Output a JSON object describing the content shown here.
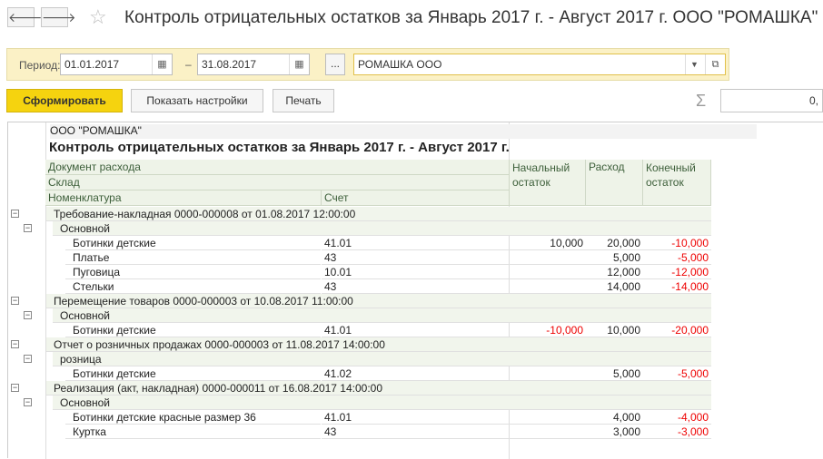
{
  "window": {
    "title": "Контроль отрицательных остатков за Январь 2017 г. - Август 2017 г. ООО \"РОМАШКА\""
  },
  "nav": {
    "back": "🡐",
    "forward": "🡒",
    "star": "☆"
  },
  "params": {
    "period_label": "Период:",
    "date_from": "01.01.2017",
    "date_to": "31.08.2017",
    "dash": "–",
    "dots": "...",
    "org": "РОМАШКА ООО"
  },
  "toolbar": {
    "generate": "Сформировать",
    "settings": "Показать настройки",
    "print": "Печать",
    "sigma": "Σ",
    "sum_value": "0,"
  },
  "report": {
    "org": "ООО \"РОМАШКА\"",
    "title": "Контроль отрицательных остатков за Январь 2017 г. - Август 2017 г.",
    "headers": {
      "doc": "Документ расхода",
      "warehouse": "Склад",
      "item": "Номенклатура",
      "account": "Счет",
      "start": "Начальный остаток",
      "expense": "Расход",
      "end": "Конечный остаток"
    },
    "rows": [
      {
        "level": 1,
        "name": "Требование-накладная 0000-000008 от 01.08.2017 12:00:00",
        "acc": "",
        "start": "",
        "exp": "",
        "end": ""
      },
      {
        "level": 2,
        "name": "Основной",
        "acc": "",
        "start": "",
        "exp": "",
        "end": ""
      },
      {
        "level": 3,
        "name": "Ботинки детские",
        "acc": "41.01",
        "start": "10,000",
        "exp": "20,000",
        "end": "-10,000"
      },
      {
        "level": 3,
        "name": "Платье",
        "acc": "43",
        "start": "",
        "exp": "5,000",
        "end": "-5,000"
      },
      {
        "level": 3,
        "name": "Пуговица",
        "acc": "10.01",
        "start": "",
        "exp": "12,000",
        "end": "-12,000"
      },
      {
        "level": 3,
        "name": "Стельки",
        "acc": "43",
        "start": "",
        "exp": "14,000",
        "end": "-14,000"
      },
      {
        "level": 1,
        "name": "Перемещение товаров 0000-000003 от 10.08.2017 11:00:00",
        "acc": "",
        "start": "",
        "exp": "",
        "end": ""
      },
      {
        "level": 2,
        "name": "Основной",
        "acc": "",
        "start": "",
        "exp": "",
        "end": ""
      },
      {
        "level": 3,
        "name": "Ботинки детские",
        "acc": "41.01",
        "start": "-10,000",
        "exp": "10,000",
        "end": "-20,000"
      },
      {
        "level": 1,
        "name": "Отчет о розничных продажах 0000-000003 от 11.08.2017 14:00:00",
        "acc": "",
        "start": "",
        "exp": "",
        "end": ""
      },
      {
        "level": 2,
        "name": "розница",
        "acc": "",
        "start": "",
        "exp": "",
        "end": ""
      },
      {
        "level": 3,
        "name": "Ботинки детские",
        "acc": "41.02",
        "start": "",
        "exp": "5,000",
        "end": "-5,000"
      },
      {
        "level": 1,
        "name": "Реализация (акт, накладная) 0000-000011 от 16.08.2017 14:00:00",
        "acc": "",
        "start": "",
        "exp": "",
        "end": ""
      },
      {
        "level": 2,
        "name": "Основной",
        "acc": "",
        "start": "",
        "exp": "",
        "end": ""
      },
      {
        "level": 3,
        "name": "Ботинки детские красные размер 36",
        "acc": "41.01",
        "start": "",
        "exp": "4,000",
        "end": "-4,000"
      },
      {
        "level": 3,
        "name": "Куртка",
        "acc": "43",
        "start": "",
        "exp": "3,000",
        "end": "-3,000"
      }
    ]
  }
}
